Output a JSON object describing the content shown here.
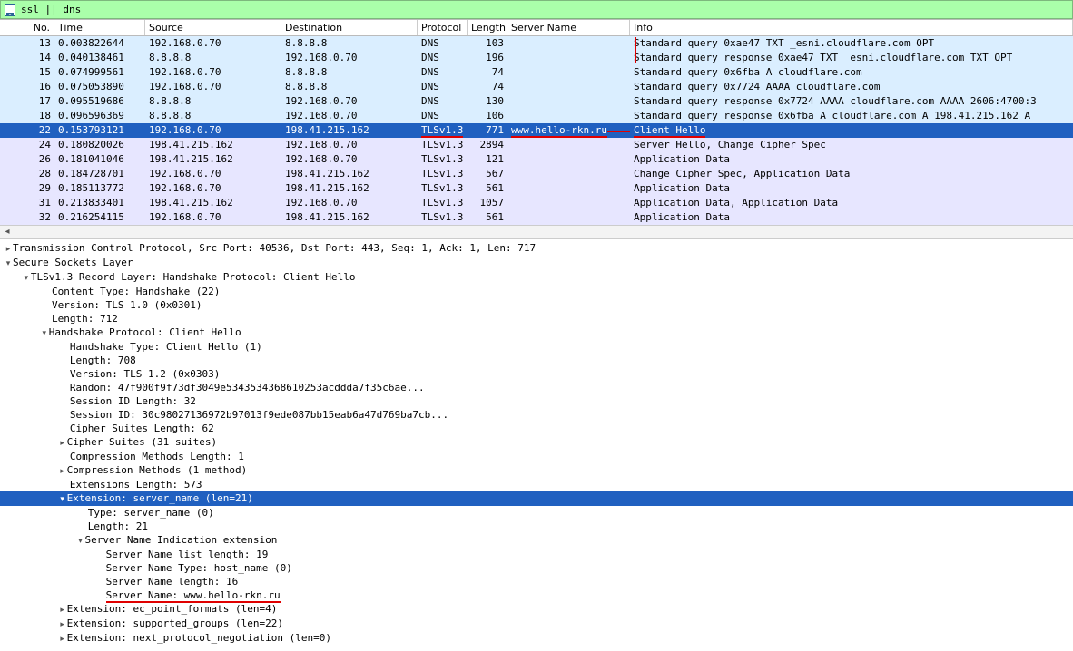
{
  "filter": {
    "value": "ssl || dns"
  },
  "columns": {
    "no": "No.",
    "time": "Time",
    "src": "Source",
    "dst": "Destination",
    "proto": "Protocol",
    "len": "Length",
    "sni": "Server Name",
    "info": "Info"
  },
  "rows": [
    {
      "bg": "dns",
      "no": "13",
      "time": "0.003822644",
      "src": "192.168.0.70",
      "dst": "8.8.8.8",
      "proto": "DNS",
      "len": "103",
      "sni": "",
      "info": "Standard query 0xae47 TXT _esni.cloudflare.com OPT"
    },
    {
      "bg": "dns",
      "no": "14",
      "time": "0.040138461",
      "src": "8.8.8.8",
      "dst": "192.168.0.70",
      "proto": "DNS",
      "len": "196",
      "sni": "",
      "info": "Standard query response 0xae47 TXT _esni.cloudflare.com TXT OPT"
    },
    {
      "bg": "dns",
      "no": "15",
      "time": "0.074999561",
      "src": "192.168.0.70",
      "dst": "8.8.8.8",
      "proto": "DNS",
      "len": "74",
      "sni": "",
      "info": "Standard query 0x6fba A cloudflare.com"
    },
    {
      "bg": "dns",
      "no": "16",
      "time": "0.075053890",
      "src": "192.168.0.70",
      "dst": "8.8.8.8",
      "proto": "DNS",
      "len": "74",
      "sni": "",
      "info": "Standard query 0x7724 AAAA cloudflare.com"
    },
    {
      "bg": "dns",
      "no": "17",
      "time": "0.095519686",
      "src": "8.8.8.8",
      "dst": "192.168.0.70",
      "proto": "DNS",
      "len": "130",
      "sni": "",
      "info": "Standard query response 0x7724 AAAA cloudflare.com AAAA 2606:4700:3"
    },
    {
      "bg": "dns",
      "no": "18",
      "time": "0.096596369",
      "src": "8.8.8.8",
      "dst": "192.168.0.70",
      "proto": "DNS",
      "len": "106",
      "sni": "",
      "info": "Standard query response 0x6fba A cloudflare.com A 198.41.215.162 A"
    },
    {
      "bg": "sel",
      "no": "22",
      "time": "0.153793121",
      "src": "192.168.0.70",
      "dst": "198.41.215.162",
      "proto": "TLSv1.3",
      "len": "771",
      "sni": "www.hello-rkn.ru",
      "info": "Client Hello",
      "ul_proto": true,
      "ul_sni_long": true,
      "ul_info": true
    },
    {
      "bg": "tls",
      "no": "24",
      "time": "0.180820026",
      "src": "198.41.215.162",
      "dst": "192.168.0.70",
      "proto": "TLSv1.3",
      "len": "2894",
      "sni": "",
      "info": "Server Hello, Change Cipher Spec"
    },
    {
      "bg": "tls",
      "no": "26",
      "time": "0.181041046",
      "src": "198.41.215.162",
      "dst": "192.168.0.70",
      "proto": "TLSv1.3",
      "len": "121",
      "sni": "",
      "info": "Application Data"
    },
    {
      "bg": "tls",
      "no": "28",
      "time": "0.184728701",
      "src": "192.168.0.70",
      "dst": "198.41.215.162",
      "proto": "TLSv1.3",
      "len": "567",
      "sni": "",
      "info": "Change Cipher Spec, Application Data"
    },
    {
      "bg": "tls",
      "no": "29",
      "time": "0.185113772",
      "src": "192.168.0.70",
      "dst": "198.41.215.162",
      "proto": "TLSv1.3",
      "len": "561",
      "sni": "",
      "info": "Application Data"
    },
    {
      "bg": "tls",
      "no": "31",
      "time": "0.213833401",
      "src": "198.41.215.162",
      "dst": "192.168.0.70",
      "proto": "TLSv1.3",
      "len": "1057",
      "sni": "",
      "info": "Application Data, Application Data"
    },
    {
      "bg": "tls",
      "no": "32",
      "time": "0.216254115",
      "src": "192.168.0.70",
      "dst": "198.41.215.162",
      "proto": "TLSv1.3",
      "len": "561",
      "sni": "",
      "info": "Application Data"
    }
  ],
  "details": {
    "tcp": "Transmission Control Protocol, Src Port: 40536, Dst Port: 443, Seq: 1, Ack: 1, Len: 717",
    "ssl": "Secure Sockets Layer",
    "record": "TLSv1.3 Record Layer: Handshake Protocol: Client Hello",
    "content_type": "Content Type: Handshake (22)",
    "version1": "Version: TLS 1.0 (0x0301)",
    "length1": "Length: 712",
    "handshake": "Handshake Protocol: Client Hello",
    "hs_type": "Handshake Type: Client Hello (1)",
    "hs_len": "Length: 708",
    "hs_ver": "Version: TLS 1.2 (0x0303)",
    "random": "Random: 47f900f9f73df3049e5343534368610253acddda7f35c6ae...",
    "sid_len": "Session ID Length: 32",
    "sid": "Session ID: 30c98027136972b97013f9ede087bb15eab6a47d769ba7cb...",
    "cs_len": "Cipher Suites Length: 62",
    "cs": "Cipher Suites (31 suites)",
    "cm_len": "Compression Methods Length: 1",
    "cm": "Compression Methods (1 method)",
    "ext_len": "Extensions Length: 573",
    "ext_sni": "Extension: server_name (len=21)",
    "sni_type": "Type: server_name (0)",
    "sni_len": "Length: 21",
    "sni_ext": "Server Name Indication extension",
    "snl_len": "Server Name list length: 19",
    "snl_type": "Server Name Type: host_name (0)",
    "snl_nlen": "Server Name length: 16",
    "snl_name": "Server Name: www.hello-rkn.ru",
    "ext_ec": "Extension: ec_point_formats (len=4)",
    "ext_sg": "Extension: supported_groups (len=22)",
    "ext_npn": "Extension: next_protocol_negotiation (len=0)"
  }
}
